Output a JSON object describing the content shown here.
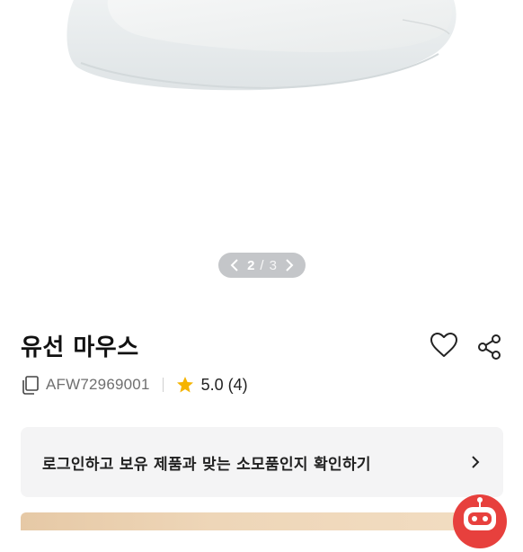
{
  "gallery": {
    "current": "2",
    "separator": "/",
    "total": "3"
  },
  "product": {
    "title": "유선 마우스",
    "sku": "AFW72969001",
    "rating": "5.0",
    "review_count": "(4)"
  },
  "login_banner": {
    "text": "로그인하고 보유 제품과 맞는 소모품인지 확인하기"
  },
  "icons": {
    "prev": "chevron-left-icon",
    "next": "chevron-right-icon",
    "wishlist": "heart-icon",
    "share": "share-icon",
    "copy": "copy-icon",
    "star": "star-icon",
    "banner_arrow": "chevron-right-icon",
    "chatbot": "robot-icon"
  },
  "colors": {
    "pager_bg": "#c4c6c9",
    "star": "#f5b400",
    "banner_bg": "#f4f4f5",
    "chatbot": "#e7403d"
  }
}
